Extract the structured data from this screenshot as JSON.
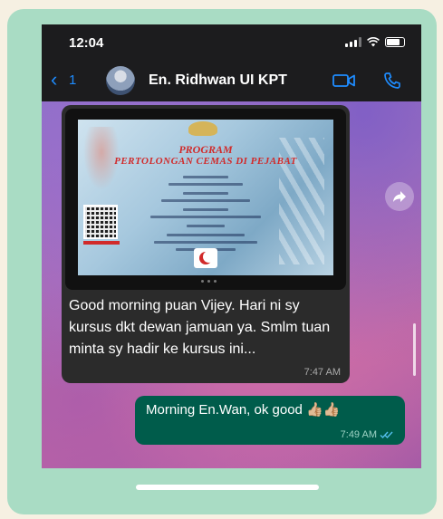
{
  "status_bar": {
    "time": "12:04"
  },
  "header": {
    "back_count": "1",
    "contact_name": "En. Ridhwan UI KPT"
  },
  "poster": {
    "title_line1": "PROGRAM",
    "title_line2": "PERTOLONGAN CEMAS DI PEJABAT"
  },
  "incoming_message": {
    "text": "Good morning puan Vijey. Hari ni sy kursus dkt dewan jamuan ya. Smlm tuan minta sy hadir ke kursus ini...",
    "time": "7:47 AM"
  },
  "outgoing_message": {
    "text": "Morning En.Wan, ok good 👍🏼👍🏼",
    "time": "7:49 AM"
  },
  "colors": {
    "card_bg": "#a9dcc4",
    "page_bg": "#f6f0e2",
    "accent_blue": "#1e8cff",
    "outgoing_bubble": "#005c4b",
    "incoming_bubble": "#2b2b2b",
    "read_ticks": "#53bdeb"
  },
  "icons": [
    "back-chevron-icon",
    "video-call-icon",
    "phone-call-icon",
    "forward-icon",
    "signal-icon",
    "wifi-icon",
    "battery-icon",
    "double-check-icon"
  ]
}
